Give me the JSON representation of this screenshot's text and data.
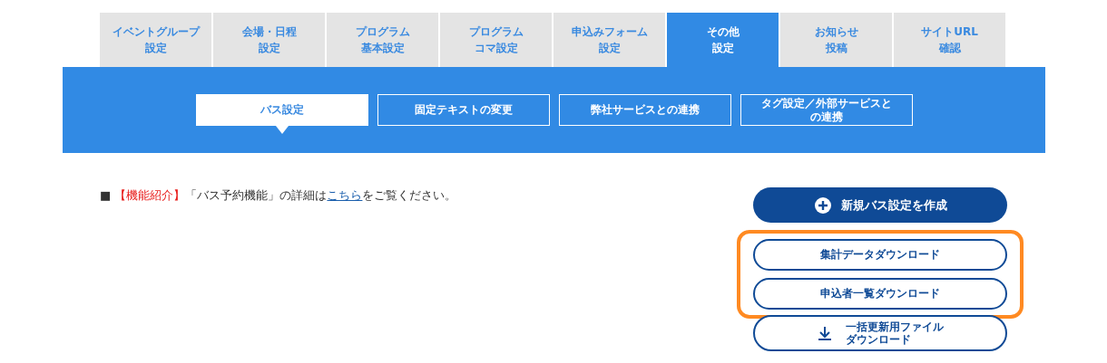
{
  "tabs": [
    {
      "lines": [
        "イベントグループ",
        "設定"
      ],
      "selected": false
    },
    {
      "lines": [
        "会場・日程",
        "設定"
      ],
      "selected": false
    },
    {
      "lines": [
        "プログラム",
        "基本設定"
      ],
      "selected": false
    },
    {
      "lines": [
        "プログラム",
        "コマ設定"
      ],
      "selected": false
    },
    {
      "lines": [
        "申込みフォーム",
        "設定"
      ],
      "selected": false
    },
    {
      "lines": [
        "その他",
        "設定"
      ],
      "selected": true
    },
    {
      "lines": [
        "お知らせ",
        "投稿"
      ],
      "selected": false
    },
    {
      "lines": [
        "サイトURL",
        "確認"
      ],
      "selected": false
    }
  ],
  "subtabs": [
    {
      "lines": [
        "バス設定"
      ],
      "selected": true
    },
    {
      "lines": [
        "固定テキストの変更"
      ],
      "selected": false
    },
    {
      "lines": [
        "弊社サービスとの連携"
      ],
      "selected": false
    },
    {
      "lines": [
        "タグ設定／外部サービスと",
        "の連携"
      ],
      "selected": false
    }
  ],
  "notice": {
    "marker": "■",
    "tag": "【機能紹介】",
    "before": "「バス予約機能」の詳細は",
    "link": "こちら",
    "after": "をご覧ください。"
  },
  "create_button": {
    "label": "新規バス設定を作成"
  },
  "download_group": {
    "highlighted": true,
    "buttons": [
      {
        "label": "集計データダウンロード"
      },
      {
        "label": "申込者一覧ダウンロード"
      }
    ]
  },
  "bulk_button": {
    "lines": [
      "一括更新用ファイル",
      "ダウンロード"
    ]
  }
}
